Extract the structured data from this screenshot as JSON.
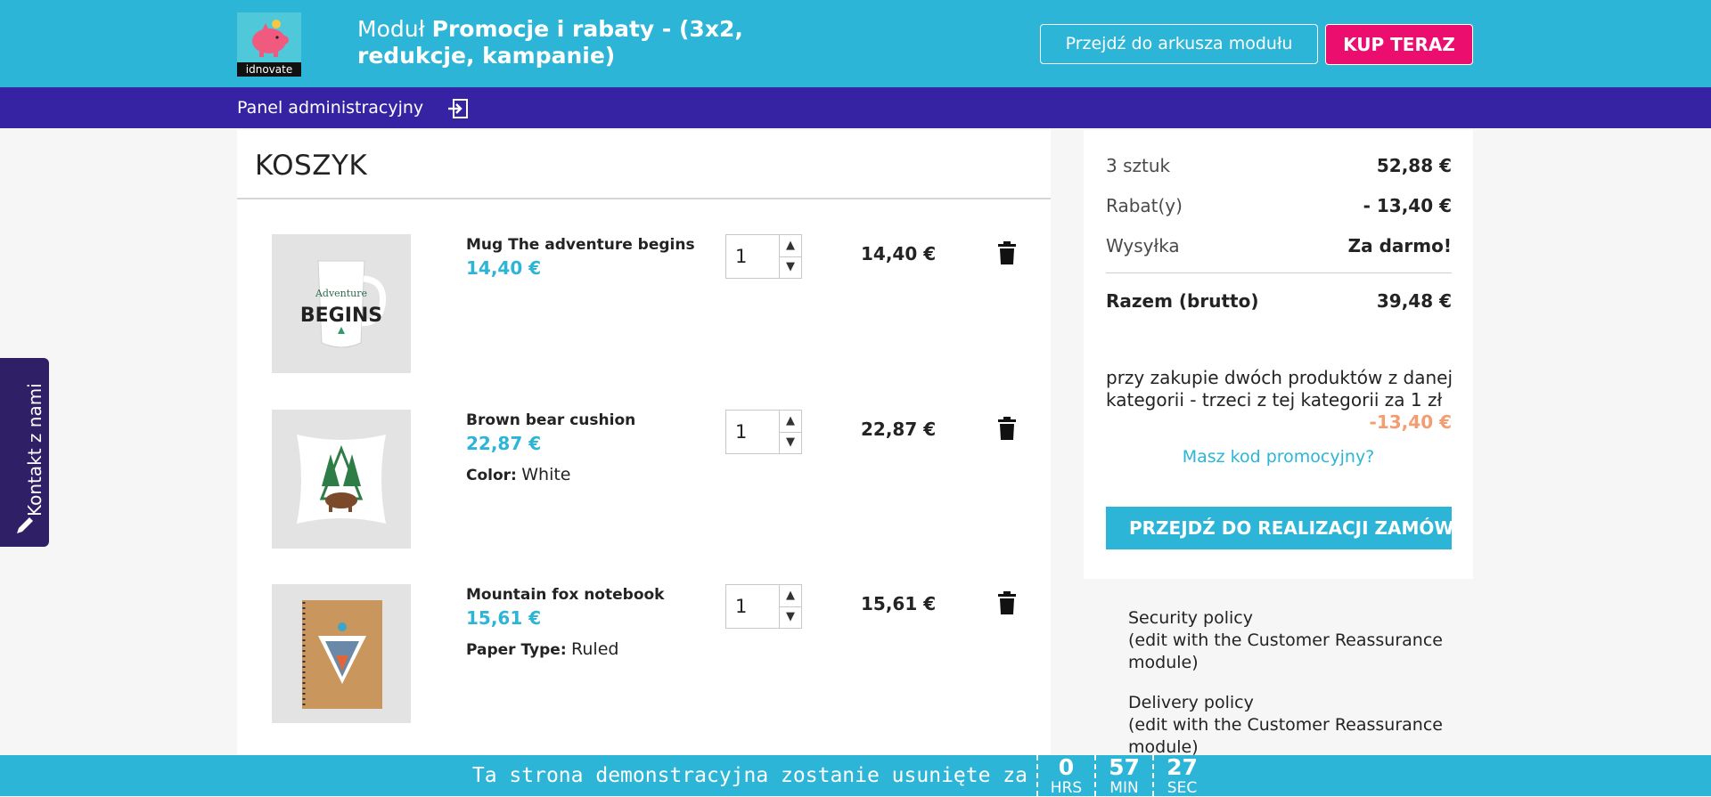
{
  "header": {
    "logo_text": "idnovate",
    "title_prefix": "Moduł ",
    "title_bold": "Promocje i rabaty - (3x2, redukcje, kampanie)",
    "sheet_button": "Przejdź do arkusza modułu",
    "buy_button": "KUP TERAZ"
  },
  "adminbar": {
    "label": "Panel administracyjny"
  },
  "cart": {
    "title": "KOSZYK",
    "items": [
      {
        "name": "Mug The adventure begins",
        "price": "14,40 €",
        "attr_key": "",
        "attr_val": "",
        "qty": "1",
        "total": "14,40 €"
      },
      {
        "name": "Brown bear cushion",
        "price": "22,87 €",
        "attr_key": "Color:",
        "attr_val": "White",
        "qty": "1",
        "total": "22,87 €"
      },
      {
        "name": "Mountain fox notebook",
        "price": "15,61 €",
        "attr_key": "Paper Type:",
        "attr_val": "Ruled",
        "qty": "1",
        "total": "15,61 €"
      }
    ]
  },
  "summary": {
    "items_label": "3 sztuk",
    "items_value": "52,88 €",
    "discount_label": "Rabat(y)",
    "discount_value": "- 13,40 €",
    "shipping_label": "Wysyłka",
    "shipping_value": "Za darmo!",
    "total_label": "Razem (brutto)",
    "total_value": "39,48 €",
    "promo_description": "przy zakupie dwóch produktów z danej kategorii - trzeci z tej kategorii za 1 zł",
    "promo_amount": "-13,40 €",
    "promo_code_link": "Masz kod promocyjny?",
    "checkout_button": "PRZEJDŹ DO REALIZACJI ZAMÓWIENIA"
  },
  "reassurance": [
    {
      "title": "Security policy",
      "desc": "(edit with the Customer Reassurance module)"
    },
    {
      "title": "Delivery policy",
      "desc": "(edit with the Customer Reassurance module)"
    }
  ],
  "contact_tab": "Kontakt z nami",
  "countdown": {
    "message": "Ta strona demonstracyjna zostanie usunięte za",
    "hours": "0",
    "hours_label": "HRS",
    "minutes": "57",
    "minutes_label": "MIN",
    "seconds": "27",
    "seconds_label": "SEC"
  },
  "colors": {
    "primary": "#2cb5d7",
    "admin_bar": "#3623a3",
    "buy": "#ec0e6f",
    "promo": "#f39d72"
  }
}
